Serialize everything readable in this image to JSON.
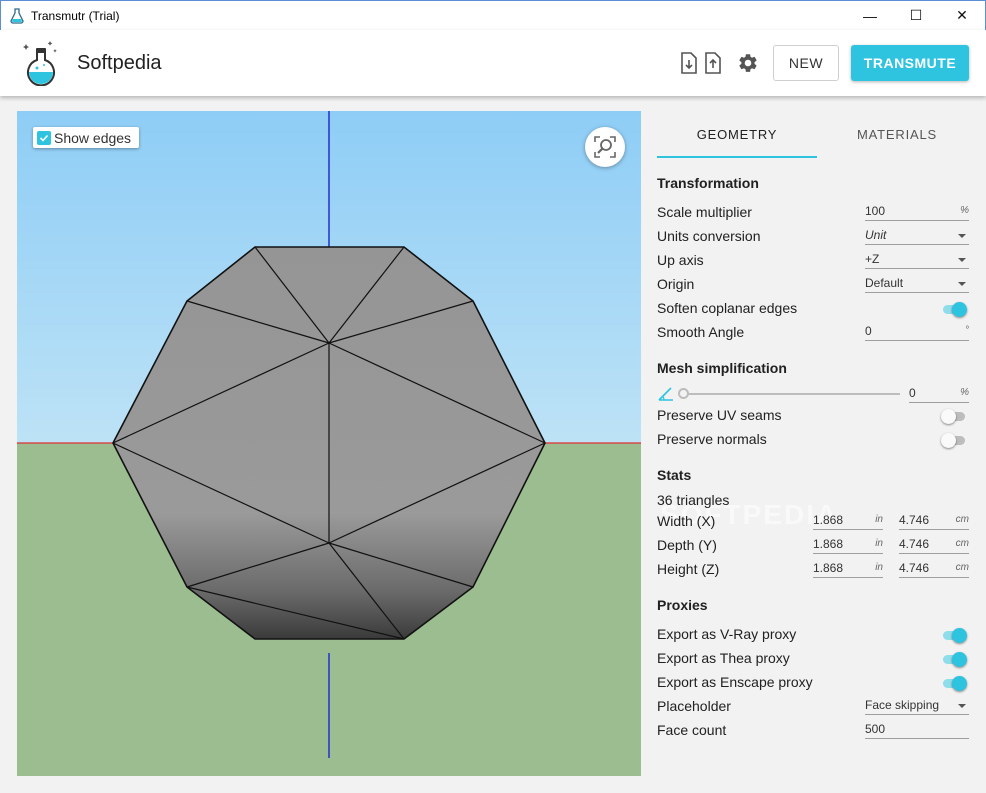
{
  "window": {
    "title": "Transmutr (Trial)",
    "min_glyph": "—",
    "max_glyph": "☐",
    "close_glyph": "✕"
  },
  "header": {
    "brand": "Softpedia",
    "new_label": "NEW",
    "transmute_label": "TRANSMUTE",
    "icons": [
      "import-file-icon",
      "export-file-icon",
      "gear-icon"
    ]
  },
  "viewport": {
    "show_edges_label": "Show edges",
    "show_edges_checked": true,
    "sky_color": "#a9d6f5",
    "ground_color": "#9bbd90"
  },
  "tabs": {
    "geometry": "GEOMETRY",
    "materials": "MATERIALS"
  },
  "transformation": {
    "title": "Transformation",
    "scale_label": "Scale multiplier",
    "scale_value": "100",
    "scale_unit": "%",
    "units_label": "Units conversion",
    "units_value": "Unit",
    "up_label": "Up axis",
    "up_value": "+Z",
    "origin_label": "Origin",
    "origin_value": "Default",
    "soften_label": "Soften coplanar edges",
    "soften_on": true,
    "smooth_label": "Smooth Angle",
    "smooth_value": "0",
    "smooth_unit": "°"
  },
  "mesh": {
    "title": "Mesh simplification",
    "slider_value": "0",
    "slider_unit": "%",
    "uv_label": "Preserve UV seams",
    "uv_on": false,
    "normals_label": "Preserve normals",
    "normals_on": false
  },
  "stats": {
    "title": "Stats",
    "triangles": "36 triangles",
    "rows": [
      {
        "label": "Width (X)",
        "in": "1.868",
        "cm": "4.746"
      },
      {
        "label": "Depth (Y)",
        "in": "1.868",
        "cm": "4.746"
      },
      {
        "label": "Height (Z)",
        "in": "1.868",
        "cm": "4.746"
      }
    ],
    "unit_in": "in",
    "unit_cm": "cm"
  },
  "proxies": {
    "title": "Proxies",
    "vray_label": "Export as V-Ray proxy",
    "vray_on": true,
    "thea_label": "Export as Thea proxy",
    "thea_on": true,
    "enscape_label": "Export as Enscape proxy",
    "enscape_on": true,
    "placeholder_label": "Placeholder",
    "placeholder_value": "Face skipping",
    "face_label": "Face count",
    "face_value": "500"
  },
  "colors": {
    "accent": "#2ec4e0",
    "accent_light": "#8fdceb",
    "axis_x": "#e03030",
    "axis_z": "#2030d0"
  }
}
